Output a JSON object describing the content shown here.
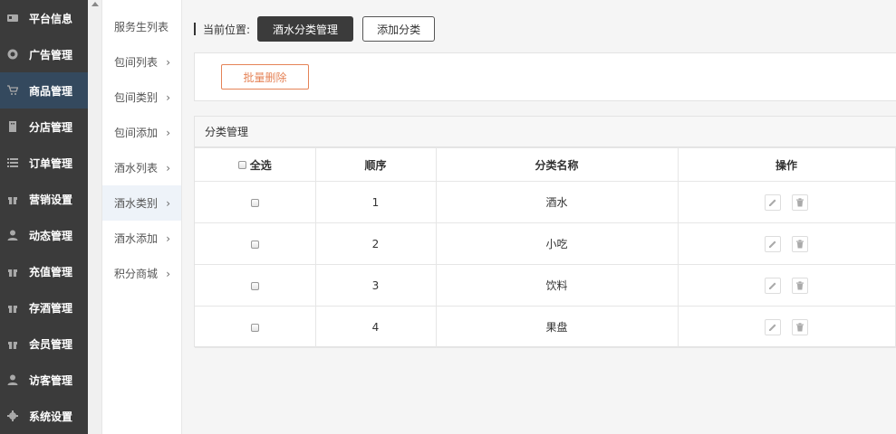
{
  "sidebar": {
    "items": [
      {
        "label": "平台信息",
        "icon": "newspaper-icon"
      },
      {
        "label": "广告管理",
        "icon": "lifebuoy-icon"
      },
      {
        "label": "商品管理",
        "icon": "cart-icon"
      },
      {
        "label": "分店管理",
        "icon": "building-icon"
      },
      {
        "label": "订单管理",
        "icon": "list-icon"
      },
      {
        "label": "营销设置",
        "icon": "gift-icon"
      },
      {
        "label": "动态管理",
        "icon": "user-icon"
      },
      {
        "label": "充值管理",
        "icon": "gift-icon"
      },
      {
        "label": "存酒管理",
        "icon": "gift-icon"
      },
      {
        "label": "会员管理",
        "icon": "gift-icon"
      },
      {
        "label": "访客管理",
        "icon": "user-icon"
      },
      {
        "label": "系统设置",
        "icon": "gear-icon"
      }
    ],
    "active_index": 2
  },
  "submenu": {
    "items": [
      {
        "label": "服务生列表",
        "chevron": ""
      },
      {
        "label": "包间列表",
        "chevron": "›"
      },
      {
        "label": "包间类别",
        "chevron": "›"
      },
      {
        "label": "包间添加",
        "chevron": "›"
      },
      {
        "label": "酒水列表",
        "chevron": "›"
      },
      {
        "label": "酒水类别",
        "chevron": "›"
      },
      {
        "label": "酒水添加",
        "chevron": "›"
      },
      {
        "label": "积分商城",
        "chevron": "›"
      }
    ],
    "active_index": 5
  },
  "breadcrumb": {
    "label": "当前位置:",
    "current": "酒水分类管理",
    "add_button": "添加分类"
  },
  "toolbar": {
    "delete_button": "批量删除"
  },
  "panel": {
    "title": "分类管理",
    "columns": [
      "全选",
      "顺序",
      "分类名称",
      "操作"
    ],
    "rows": [
      {
        "order": "1",
        "name": "酒水"
      },
      {
        "order": "2",
        "name": "小吃"
      },
      {
        "order": "3",
        "name": "饮料"
      },
      {
        "order": "4",
        "name": "果盘"
      }
    ]
  },
  "colors": {
    "sidebar_bg": "#3b3b3b",
    "sidebar_active": "#34495e",
    "delete_accent": "#e58357"
  }
}
